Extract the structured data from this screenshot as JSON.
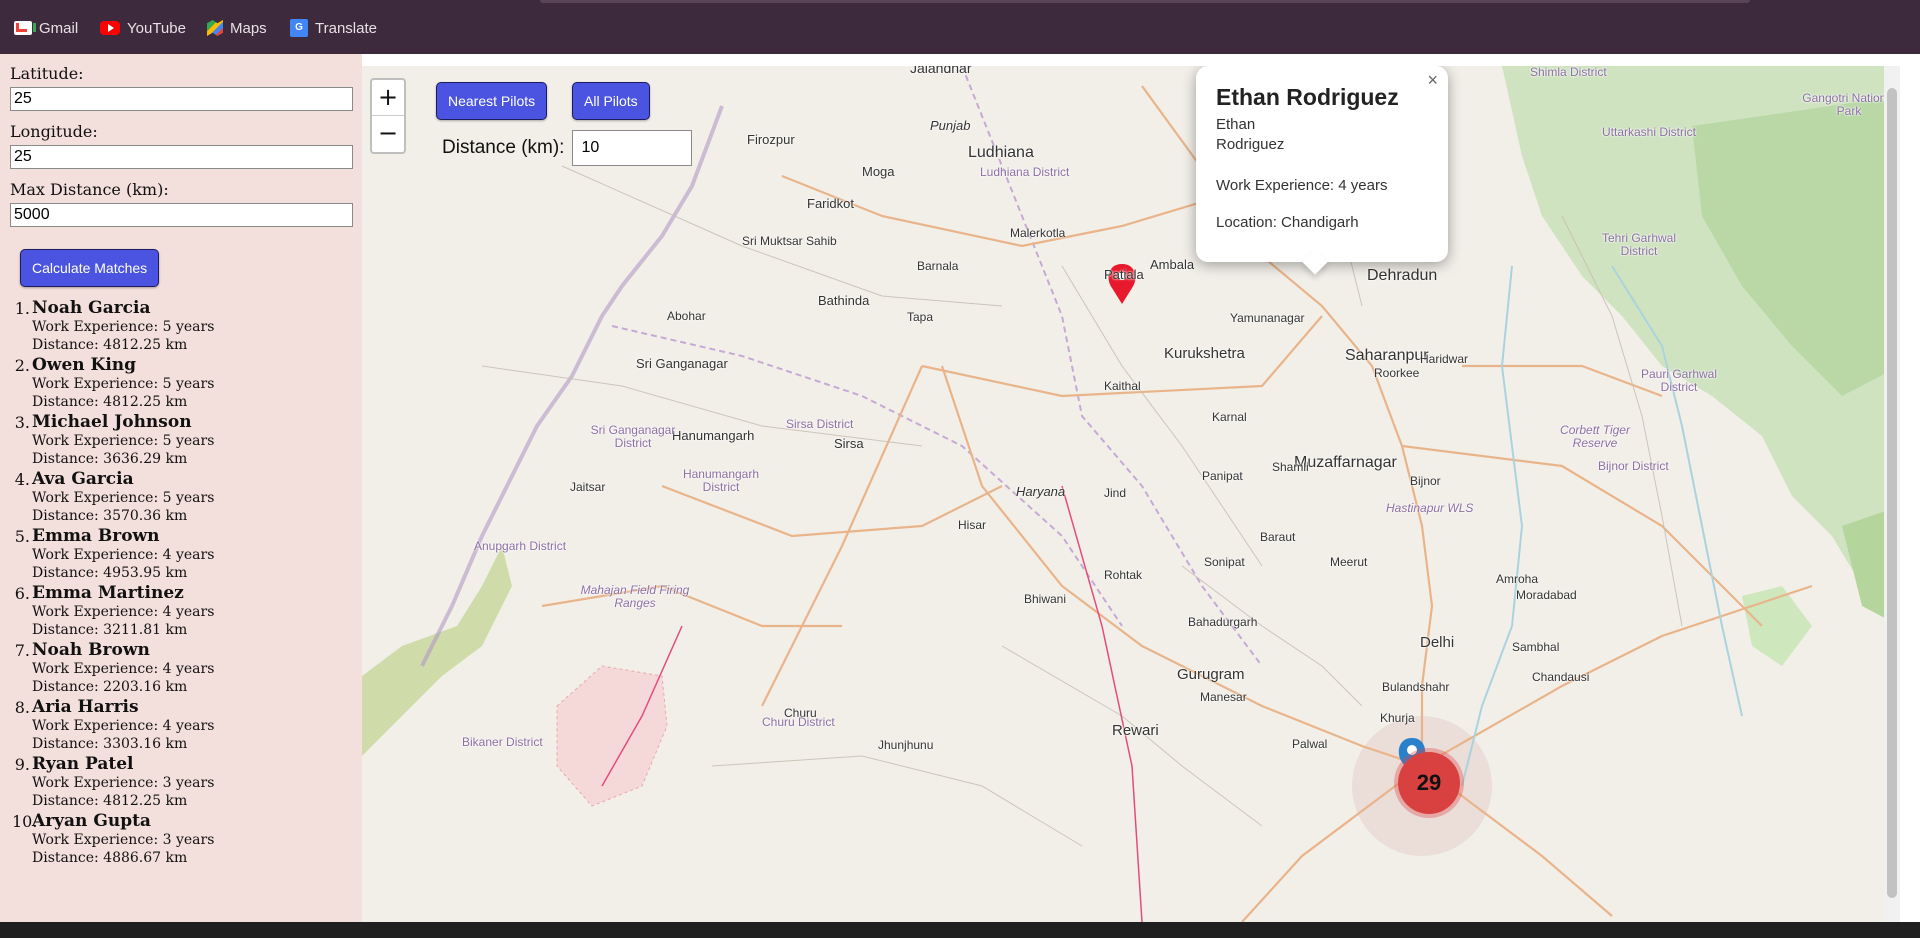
{
  "bookmarks": [
    {
      "label": "Gmail",
      "icon": "gmail-icon"
    },
    {
      "label": "YouTube",
      "icon": "youtube-icon"
    },
    {
      "label": "Maps",
      "icon": "maps-icon"
    },
    {
      "label": "Translate",
      "icon": "translate-icon"
    }
  ],
  "form": {
    "latitude_label": "Latitude:",
    "latitude_value": "25",
    "longitude_label": "Longitude:",
    "longitude_value": "25",
    "max_distance_label": "Max Distance (km):",
    "max_distance_value": "5000",
    "calculate_label": "Calculate Matches"
  },
  "results": [
    {
      "num": "1.",
      "name": "Noah Garcia",
      "experience": "Work Experience: 5 years",
      "distance": "Distance: 4812.25 km"
    },
    {
      "num": "2.",
      "name": "Owen King",
      "experience": "Work Experience: 5 years",
      "distance": "Distance: 4812.25 km"
    },
    {
      "num": "3.",
      "name": "Michael Johnson",
      "experience": "Work Experience: 5 years",
      "distance": "Distance: 3636.29 km"
    },
    {
      "num": "4.",
      "name": "Ava Garcia",
      "experience": "Work Experience: 5 years",
      "distance": "Distance: 3570.36 km"
    },
    {
      "num": "5.",
      "name": "Emma Brown",
      "experience": "Work Experience: 4 years",
      "distance": "Distance: 4953.95 km"
    },
    {
      "num": "6.",
      "name": "Emma Martinez",
      "experience": "Work Experience: 4 years",
      "distance": "Distance: 3211.81 km"
    },
    {
      "num": "7.",
      "name": "Noah Brown",
      "experience": "Work Experience: 4 years",
      "distance": "Distance: 2203.16 km"
    },
    {
      "num": "8.",
      "name": "Aria Harris",
      "experience": "Work Experience: 4 years",
      "distance": "Distance: 3303.16 km"
    },
    {
      "num": "9.",
      "name": "Ryan Patel",
      "experience": "Work Experience: 3 years",
      "distance": "Distance: 4812.25 km"
    },
    {
      "num": "10.",
      "name": "Aryan Gupta",
      "experience": "Work Experience: 3 years",
      "distance": "Distance: 4886.67 km"
    }
  ],
  "map": {
    "zoom_in": "+",
    "zoom_out": "−",
    "nearest_label": "Nearest Pilots",
    "all_label": "All Pilots",
    "distance_label": "Distance (km):",
    "distance_value": "10",
    "cluster_count": "29",
    "places": [
      "Jalandhar",
      "Ludhiana",
      "Moga",
      "Firozpur",
      "Faridkot",
      "Sri Muktsar Sahib",
      "Malerkotla",
      "Barnala",
      "Bathinda",
      "Patiala",
      "Ambala",
      "Abohar",
      "Tapa",
      "Sri Ganganagar",
      "Kurukshetra",
      "Yamunanagar",
      "Saharanpur",
      "Dehradun",
      "Kaithal",
      "Karnal",
      "Hanumangarh",
      "Sirsa",
      "Panipat",
      "Muzaffarnagar",
      "Jind",
      "Shamli",
      "Hisar",
      "Sonipat",
      "Meerut",
      "Rohtak",
      "Bhiwani",
      "Bahadurgarh",
      "Delhi",
      "Gurugram",
      "Rewari",
      "Churu",
      "Jhunjhunu",
      "Palwal",
      "Khurja",
      "Bulandshahr",
      "Amroha",
      "Moradabad",
      "Sambhal",
      "Chandausi",
      "Roorkee",
      "Haridwar",
      "Bijnor",
      "Jaitsar",
      "Baraut",
      "Manesar",
      "Punjab",
      "Haryana",
      "Sirsa District",
      "Hanumangarh District",
      "Sri Ganganagar District",
      "Anupgarh District",
      "Churu District",
      "Bikaner District",
      "Ludhiana District",
      "Mahajan Field Firing Ranges",
      "Corbett Tiger Reserve",
      "Hastinapur WLS",
      "Shimla District",
      "Uttarkashi District",
      "Tehri Garhwal District",
      "Pauri Garhwal District",
      "Bijnor District",
      "Gangotri National Park"
    ]
  },
  "popup": {
    "close": "×",
    "name": "Ethan Rodriguez",
    "image_alt": "Ethan Rodriguez",
    "experience": "Work Experience: 4 years",
    "location": "Location: Chandigarh"
  },
  "colors": {
    "button": "#4b54e0",
    "sidebar": "#f3dfdb",
    "topbar": "#3d2a3c",
    "cluster": "#d94040",
    "marker_red": "#e8192c",
    "marker_blue": "#2a81cb"
  }
}
